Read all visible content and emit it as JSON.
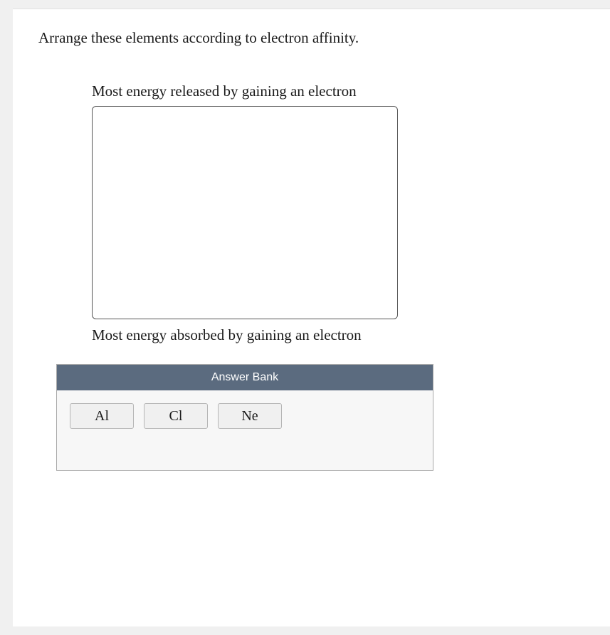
{
  "question": {
    "prompt": "Arrange these elements according to electron affinity."
  },
  "ranking": {
    "top_label": "Most energy released by gaining an electron",
    "bottom_label": "Most energy absorbed by gaining an electron"
  },
  "answer_bank": {
    "header": "Answer Bank",
    "items": [
      {
        "label": "Al"
      },
      {
        "label": "Cl"
      },
      {
        "label": "Ne"
      }
    ]
  }
}
